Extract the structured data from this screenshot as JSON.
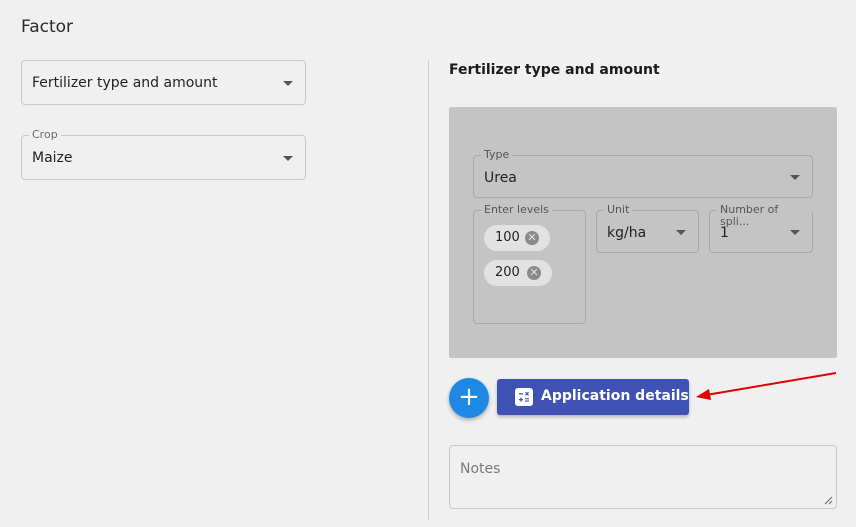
{
  "page": {
    "title": "Factor"
  },
  "left": {
    "factor_select": {
      "value": "Fertilizer type and amount"
    },
    "crop_select": {
      "label": "Crop",
      "value": "Maize"
    }
  },
  "right": {
    "section_title": "Fertilizer type and amount",
    "type_select": {
      "label": "Type",
      "value": "Urea"
    },
    "levels": {
      "label": "Enter levels",
      "chips": [
        "100",
        "200"
      ]
    },
    "unit_select": {
      "label": "Unit",
      "value": "kg/ha"
    },
    "splits_select": {
      "label": "Number of spli...",
      "value": "1"
    },
    "add_button": {
      "label": "+"
    },
    "application_button": {
      "label": "Application details",
      "icon": "calculator-icon"
    },
    "notes": {
      "placeholder": "Notes"
    }
  },
  "colors": {
    "background": "#f0f0f0",
    "panel": "#c4c4c4",
    "fab": "#1e88e5",
    "primary_button": "#3f51b5",
    "annotation_arrow": "#e00000"
  }
}
